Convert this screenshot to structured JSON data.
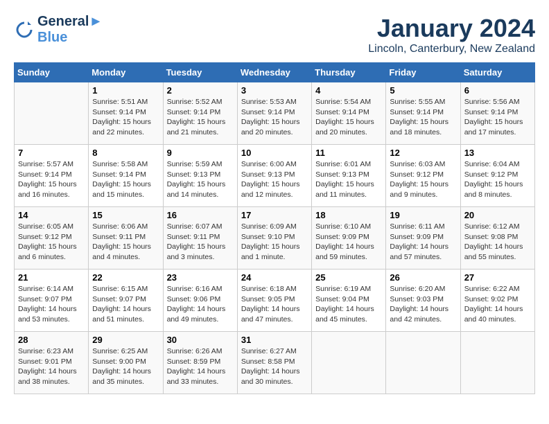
{
  "logo": {
    "line1": "General",
    "line2": "Blue"
  },
  "title": "January 2024",
  "location": "Lincoln, Canterbury, New Zealand",
  "headers": [
    "Sunday",
    "Monday",
    "Tuesday",
    "Wednesday",
    "Thursday",
    "Friday",
    "Saturday"
  ],
  "weeks": [
    [
      {
        "num": "",
        "sunrise": "",
        "sunset": "",
        "daylight": ""
      },
      {
        "num": "1",
        "sunrise": "Sunrise: 5:51 AM",
        "sunset": "Sunset: 9:14 PM",
        "daylight": "Daylight: 15 hours and 22 minutes."
      },
      {
        "num": "2",
        "sunrise": "Sunrise: 5:52 AM",
        "sunset": "Sunset: 9:14 PM",
        "daylight": "Daylight: 15 hours and 21 minutes."
      },
      {
        "num": "3",
        "sunrise": "Sunrise: 5:53 AM",
        "sunset": "Sunset: 9:14 PM",
        "daylight": "Daylight: 15 hours and 20 minutes."
      },
      {
        "num": "4",
        "sunrise": "Sunrise: 5:54 AM",
        "sunset": "Sunset: 9:14 PM",
        "daylight": "Daylight: 15 hours and 20 minutes."
      },
      {
        "num": "5",
        "sunrise": "Sunrise: 5:55 AM",
        "sunset": "Sunset: 9:14 PM",
        "daylight": "Daylight: 15 hours and 18 minutes."
      },
      {
        "num": "6",
        "sunrise": "Sunrise: 5:56 AM",
        "sunset": "Sunset: 9:14 PM",
        "daylight": "Daylight: 15 hours and 17 minutes."
      }
    ],
    [
      {
        "num": "7",
        "sunrise": "Sunrise: 5:57 AM",
        "sunset": "Sunset: 9:14 PM",
        "daylight": "Daylight: 15 hours and 16 minutes."
      },
      {
        "num": "8",
        "sunrise": "Sunrise: 5:58 AM",
        "sunset": "Sunset: 9:14 PM",
        "daylight": "Daylight: 15 hours and 15 minutes."
      },
      {
        "num": "9",
        "sunrise": "Sunrise: 5:59 AM",
        "sunset": "Sunset: 9:13 PM",
        "daylight": "Daylight: 15 hours and 14 minutes."
      },
      {
        "num": "10",
        "sunrise": "Sunrise: 6:00 AM",
        "sunset": "Sunset: 9:13 PM",
        "daylight": "Daylight: 15 hours and 12 minutes."
      },
      {
        "num": "11",
        "sunrise": "Sunrise: 6:01 AM",
        "sunset": "Sunset: 9:13 PM",
        "daylight": "Daylight: 15 hours and 11 minutes."
      },
      {
        "num": "12",
        "sunrise": "Sunrise: 6:03 AM",
        "sunset": "Sunset: 9:12 PM",
        "daylight": "Daylight: 15 hours and 9 minutes."
      },
      {
        "num": "13",
        "sunrise": "Sunrise: 6:04 AM",
        "sunset": "Sunset: 9:12 PM",
        "daylight": "Daylight: 15 hours and 8 minutes."
      }
    ],
    [
      {
        "num": "14",
        "sunrise": "Sunrise: 6:05 AM",
        "sunset": "Sunset: 9:12 PM",
        "daylight": "Daylight: 15 hours and 6 minutes."
      },
      {
        "num": "15",
        "sunrise": "Sunrise: 6:06 AM",
        "sunset": "Sunset: 9:11 PM",
        "daylight": "Daylight: 15 hours and 4 minutes."
      },
      {
        "num": "16",
        "sunrise": "Sunrise: 6:07 AM",
        "sunset": "Sunset: 9:11 PM",
        "daylight": "Daylight: 15 hours and 3 minutes."
      },
      {
        "num": "17",
        "sunrise": "Sunrise: 6:09 AM",
        "sunset": "Sunset: 9:10 PM",
        "daylight": "Daylight: 15 hours and 1 minute."
      },
      {
        "num": "18",
        "sunrise": "Sunrise: 6:10 AM",
        "sunset": "Sunset: 9:09 PM",
        "daylight": "Daylight: 14 hours and 59 minutes."
      },
      {
        "num": "19",
        "sunrise": "Sunrise: 6:11 AM",
        "sunset": "Sunset: 9:09 PM",
        "daylight": "Daylight: 14 hours and 57 minutes."
      },
      {
        "num": "20",
        "sunrise": "Sunrise: 6:12 AM",
        "sunset": "Sunset: 9:08 PM",
        "daylight": "Daylight: 14 hours and 55 minutes."
      }
    ],
    [
      {
        "num": "21",
        "sunrise": "Sunrise: 6:14 AM",
        "sunset": "Sunset: 9:07 PM",
        "daylight": "Daylight: 14 hours and 53 minutes."
      },
      {
        "num": "22",
        "sunrise": "Sunrise: 6:15 AM",
        "sunset": "Sunset: 9:07 PM",
        "daylight": "Daylight: 14 hours and 51 minutes."
      },
      {
        "num": "23",
        "sunrise": "Sunrise: 6:16 AM",
        "sunset": "Sunset: 9:06 PM",
        "daylight": "Daylight: 14 hours and 49 minutes."
      },
      {
        "num": "24",
        "sunrise": "Sunrise: 6:18 AM",
        "sunset": "Sunset: 9:05 PM",
        "daylight": "Daylight: 14 hours and 47 minutes."
      },
      {
        "num": "25",
        "sunrise": "Sunrise: 6:19 AM",
        "sunset": "Sunset: 9:04 PM",
        "daylight": "Daylight: 14 hours and 45 minutes."
      },
      {
        "num": "26",
        "sunrise": "Sunrise: 6:20 AM",
        "sunset": "Sunset: 9:03 PM",
        "daylight": "Daylight: 14 hours and 42 minutes."
      },
      {
        "num": "27",
        "sunrise": "Sunrise: 6:22 AM",
        "sunset": "Sunset: 9:02 PM",
        "daylight": "Daylight: 14 hours and 40 minutes."
      }
    ],
    [
      {
        "num": "28",
        "sunrise": "Sunrise: 6:23 AM",
        "sunset": "Sunset: 9:01 PM",
        "daylight": "Daylight: 14 hours and 38 minutes."
      },
      {
        "num": "29",
        "sunrise": "Sunrise: 6:25 AM",
        "sunset": "Sunset: 9:00 PM",
        "daylight": "Daylight: 14 hours and 35 minutes."
      },
      {
        "num": "30",
        "sunrise": "Sunrise: 6:26 AM",
        "sunset": "Sunset: 8:59 PM",
        "daylight": "Daylight: 14 hours and 33 minutes."
      },
      {
        "num": "31",
        "sunrise": "Sunrise: 6:27 AM",
        "sunset": "Sunset: 8:58 PM",
        "daylight": "Daylight: 14 hours and 30 minutes."
      },
      {
        "num": "",
        "sunrise": "",
        "sunset": "",
        "daylight": ""
      },
      {
        "num": "",
        "sunrise": "",
        "sunset": "",
        "daylight": ""
      },
      {
        "num": "",
        "sunrise": "",
        "sunset": "",
        "daylight": ""
      }
    ]
  ]
}
